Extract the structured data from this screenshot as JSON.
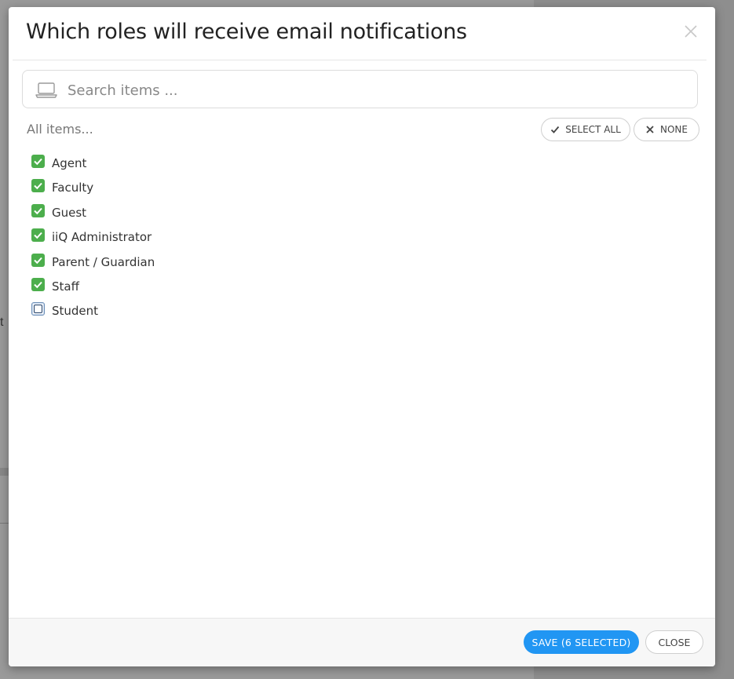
{
  "background": {
    "partial_text": "t"
  },
  "modal": {
    "title": "Which roles will receive email notifications",
    "close_icon": "close-icon"
  },
  "search": {
    "placeholder": "Search items ...",
    "value": "",
    "icon": "laptop-icon"
  },
  "list_header": {
    "label": "All items...",
    "select_all_label": "SELECT ALL",
    "none_label": "NONE"
  },
  "items": [
    {
      "label": "Agent",
      "checked": true
    },
    {
      "label": "Faculty",
      "checked": true
    },
    {
      "label": "Guest",
      "checked": true
    },
    {
      "label": "iiQ Administrator",
      "checked": true
    },
    {
      "label": "Parent / Guardian",
      "checked": true
    },
    {
      "label": "Staff",
      "checked": true
    },
    {
      "label": "Student",
      "checked": false
    }
  ],
  "footer": {
    "save_label": "SAVE (6 SELECTED)",
    "close_label": "CLOSE"
  },
  "colors": {
    "accent": "#2196f3",
    "checkbox_checked": "#4cae4c"
  }
}
